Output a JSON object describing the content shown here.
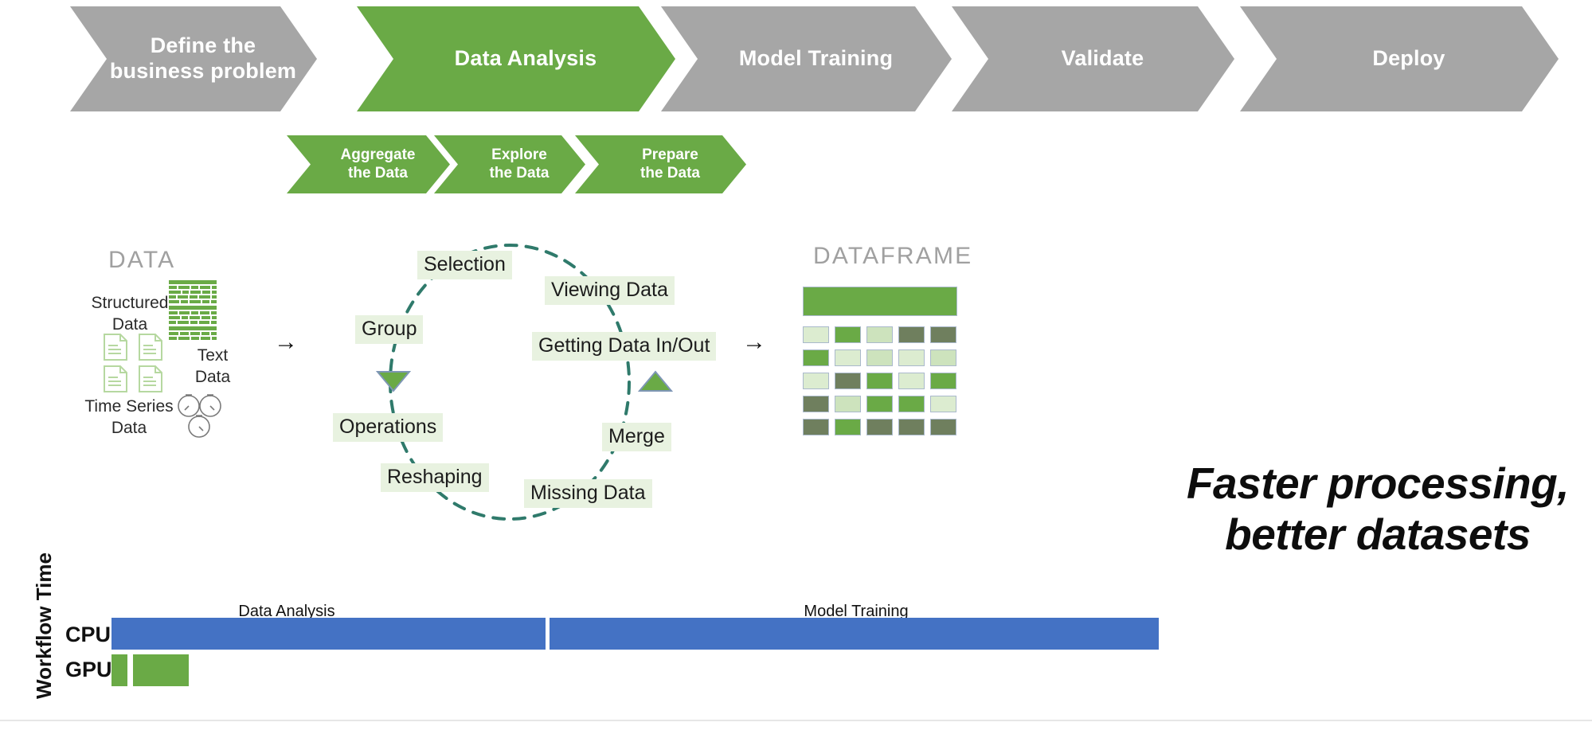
{
  "pipeline": {
    "stages": [
      {
        "label": "Define the\nbusiness problem",
        "state": "inactive",
        "color": "#a6a6a6"
      },
      {
        "label": "Data Analysis",
        "state": "active",
        "color": "#6aaa46"
      },
      {
        "label": "Model Training",
        "state": "inactive",
        "color": "#a6a6a6"
      },
      {
        "label": "Validate",
        "state": "inactive",
        "color": "#a6a6a6"
      },
      {
        "label": "Deploy",
        "state": "inactive",
        "color": "#a6a6a6"
      }
    ],
    "substages": [
      {
        "label": "Aggregate\nthe Data"
      },
      {
        "label": "Explore\nthe Data"
      },
      {
        "label": "Prepare\nthe Data"
      }
    ]
  },
  "data_section": {
    "title": "DATA",
    "items": [
      {
        "label": "Structured\nData",
        "icon": "brick-table-icon"
      },
      {
        "label": "Text\nData",
        "icon": "documents-icon"
      },
      {
        "label": "Time Series\nData",
        "icon": "stopwatches-icon"
      }
    ]
  },
  "cycle": {
    "nodes": [
      "Selection",
      "Viewing Data",
      "Getting Data In/Out",
      "Merge",
      "Missing Data",
      "Reshaping",
      "Operations",
      "Group"
    ]
  },
  "dataframe_section": {
    "title": "DATAFRAME",
    "header_color": "#6aaa46",
    "cell_colors": [
      [
        "#dcecd0",
        "#6aaa46",
        "#cde3bd",
        "#6f7f5e",
        "#6f7f5e"
      ],
      [
        "#6aaa46",
        "#dcecd0",
        "#cde3bd",
        "#dcecd0",
        "#cde3bd"
      ],
      [
        "#dcecd0",
        "#6f7f5e",
        "#6aaa46",
        "#dcecd0",
        "#6aaa46"
      ],
      [
        "#6f7f5e",
        "#cde3bd",
        "#6aaa46",
        "#6aaa46",
        "#dcecd0"
      ],
      [
        "#6f7f5e",
        "#6aaa46",
        "#6f7f5e",
        "#6f7f5e",
        "#6f7f5e"
      ]
    ]
  },
  "flow_arrows": [
    "→",
    "→"
  ],
  "tagline": "Faster processing,\nbetter datasets",
  "chart_data": {
    "type": "bar",
    "title": "",
    "ylabel": "Workflow Time",
    "xlabel": "",
    "orientation": "horizontal",
    "categories": [
      "CPU",
      "GPU"
    ],
    "segments": [
      "Data Analysis",
      "Model Training"
    ],
    "segment_labels": [
      "Data Analysis",
      "Model Training"
    ],
    "series": [
      {
        "name": "CPU",
        "color": "#4472c4",
        "values": [
          545,
          765
        ],
        "unit": "px"
      },
      {
        "name": "GPU",
        "color": "#6aaa46",
        "values": [
          20,
          70
        ],
        "unit": "px"
      }
    ],
    "grid": false,
    "legend": "none",
    "annotation": "Faster processing, better datasets"
  }
}
